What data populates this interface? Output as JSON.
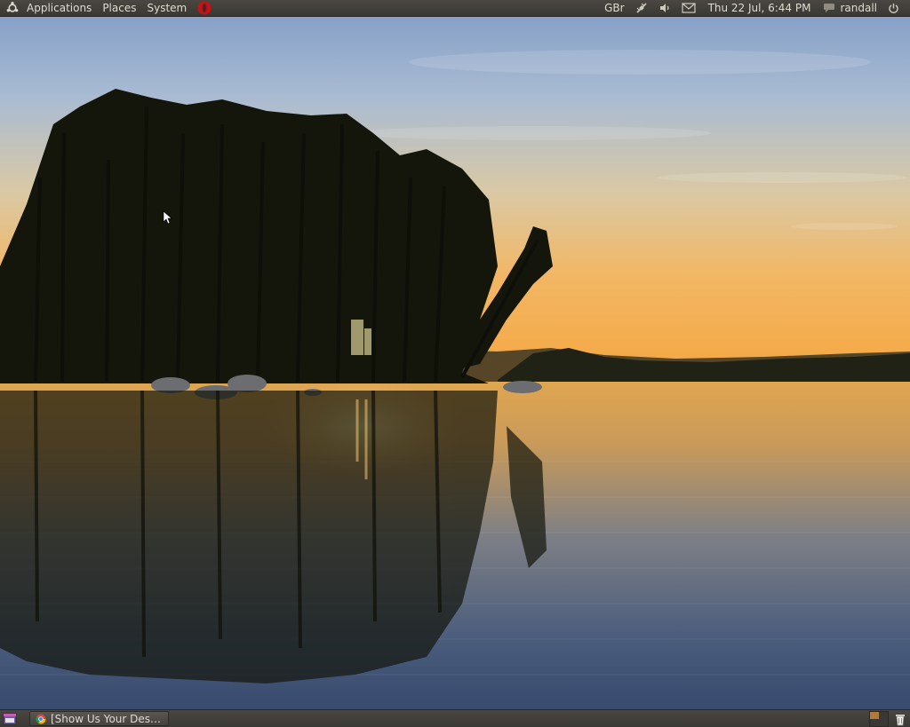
{
  "top_panel": {
    "menus": [
      "Applications",
      "Places",
      "System"
    ],
    "keyboard_layout": "GBr",
    "clock": "Thu 22 Jul,  6:44 PM",
    "username": "randall",
    "icons": {
      "logo": "ubuntu-logo-icon",
      "browser": "opera-icon",
      "network": "network-icon",
      "volume": "volume-icon",
      "mail": "mail-icon",
      "chat": "chat-icon",
      "power": "power-icon"
    }
  },
  "bottom_panel": {
    "task_title": "[Show Us Your Deskto...",
    "icons": {
      "show_desktop": "show-desktop-icon",
      "task": "chrome-icon",
      "trash": "trash-icon"
    }
  },
  "colors": {
    "panel": "#3c3b37",
    "panel_text": "#dfdbd2",
    "sky_top": "#8aa4c8",
    "sunset_glow": "#f6b04a",
    "water": "#3f5575"
  }
}
